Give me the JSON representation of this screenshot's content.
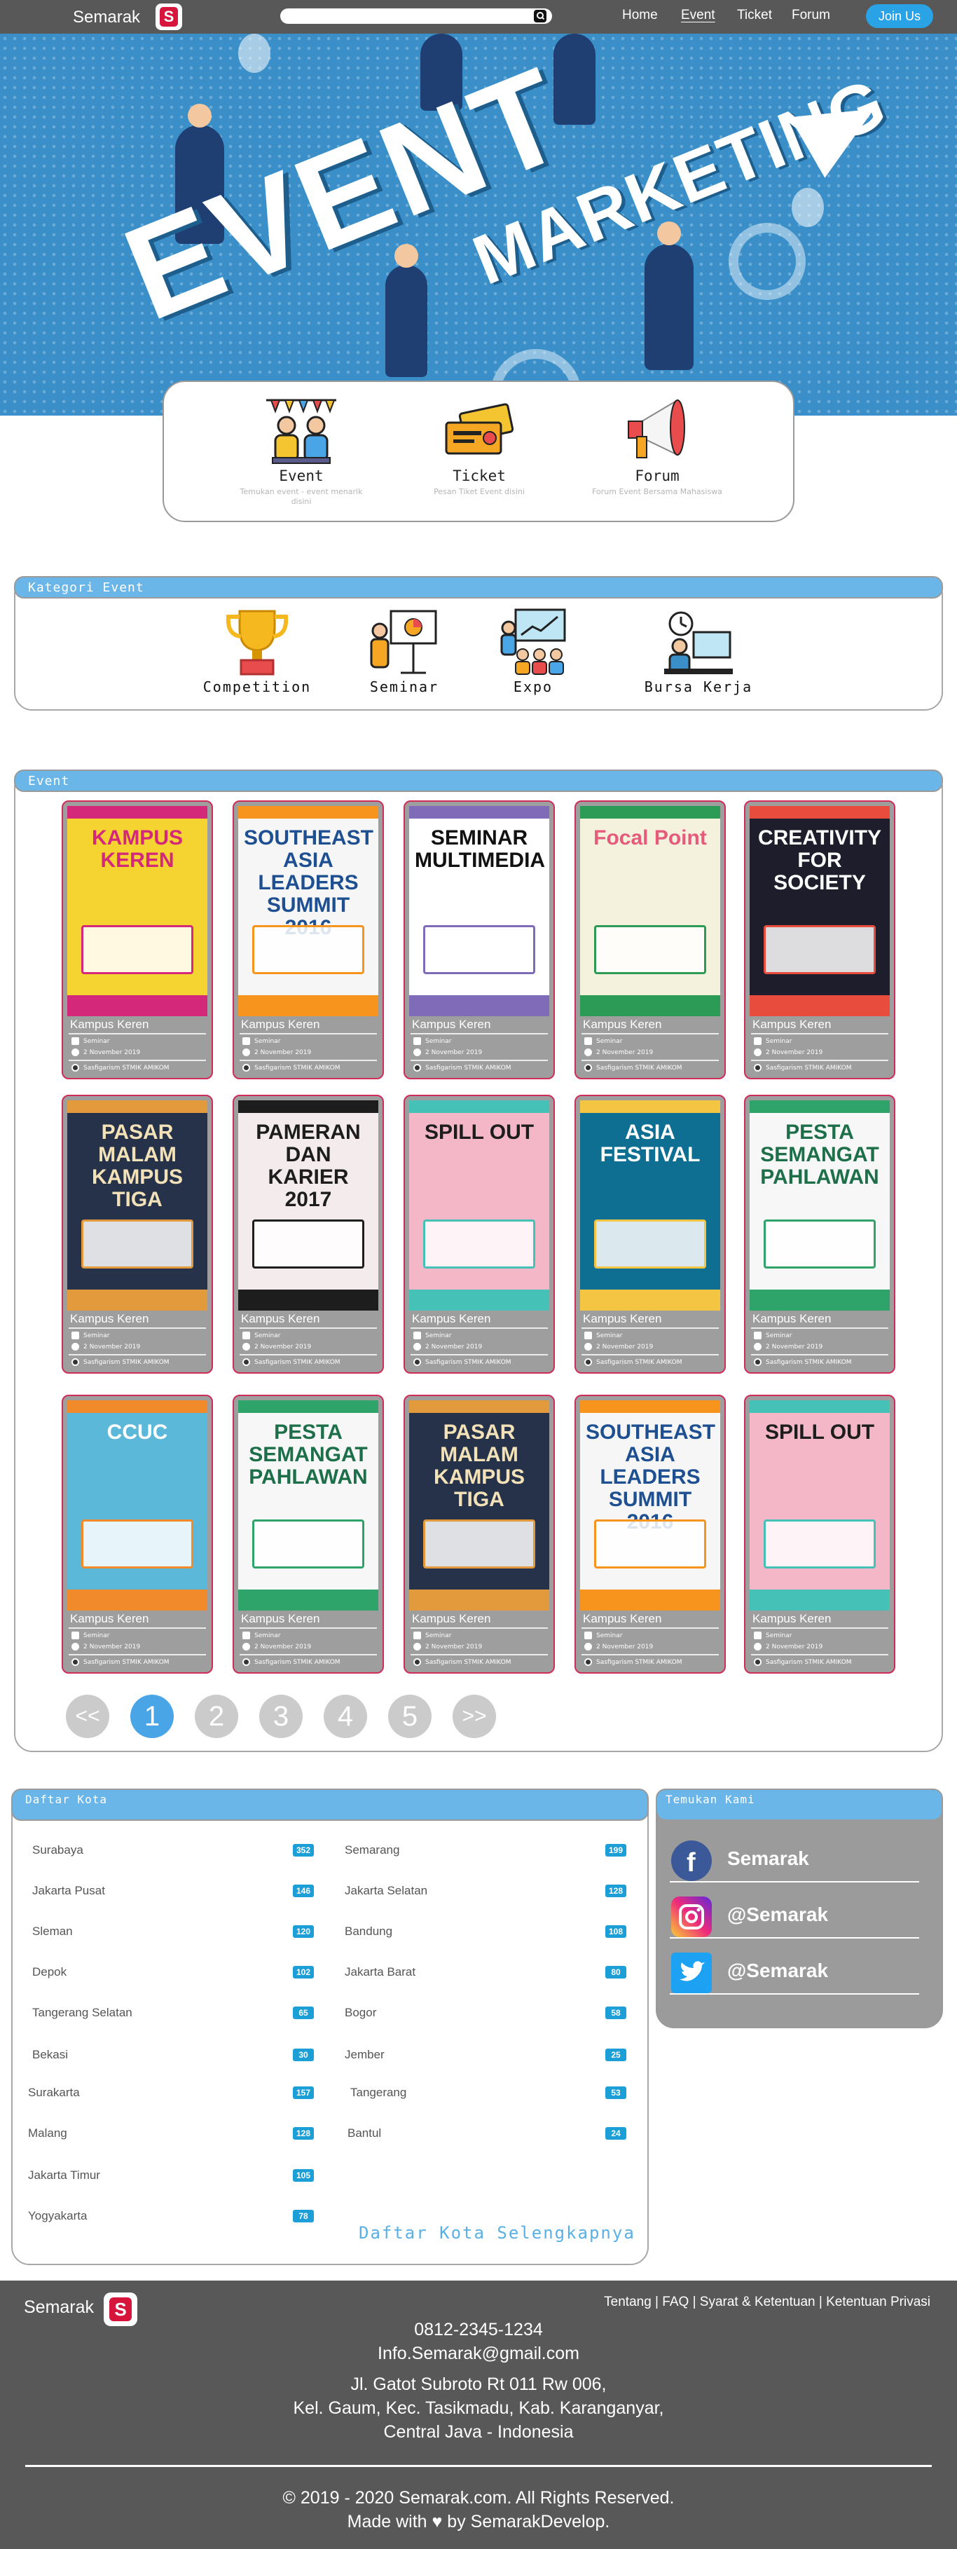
{
  "navbar": {
    "brand": "Semarak",
    "logo_letter": "S",
    "search_placeholder": "",
    "links": [
      "Home",
      "Event",
      "Ticket",
      "Forum"
    ],
    "active_link": "Event",
    "join_label": "Join Us"
  },
  "hero": {
    "headline_1": "EVENT",
    "headline_2": "MARKETING",
    "slides": 4,
    "active_slide": 1
  },
  "services": [
    {
      "title": "Event",
      "desc": "Temukan event - event menarik disini",
      "icon": "event-celebration-icon"
    },
    {
      "title": "Ticket",
      "desc": "Pesan Tiket Event disini",
      "icon": "ticket-icon"
    },
    {
      "title": "Forum",
      "desc": "Forum Event Bersama Mahasiswa",
      "icon": "megaphone-icon"
    }
  ],
  "kategori": {
    "heading": "Kategori Event",
    "items": [
      {
        "label": "Competition",
        "icon": "trophy-icon"
      },
      {
        "label": "Seminar",
        "icon": "presentation-icon"
      },
      {
        "label": "Expo",
        "icon": "expo-icon"
      },
      {
        "label": "Bursa Kerja",
        "icon": "job-fair-icon"
      }
    ]
  },
  "events": {
    "heading": "Event",
    "items": [
      {
        "title": "Kampus Keren",
        "category": "Seminar",
        "date": "2 November 2019",
        "organizer": "Sasfigarism STMIK AMIKOM",
        "poster": {
          "bg": "#f5d431",
          "accent": "#d4297b",
          "text": "KAMPUS KEREN",
          "text_color": "#d4297b"
        }
      },
      {
        "title": "Kampus Keren",
        "category": "Seminar",
        "date": "2 November 2019",
        "organizer": "Sasfigarism STMIK AMIKOM",
        "poster": {
          "bg": "#f6f6f6",
          "accent": "#f7941d",
          "text": "SOUTHEAST ASIA LEADERS SUMMIT 2016",
          "text_color": "#1d4f91"
        }
      },
      {
        "title": "Kampus Keren",
        "category": "Seminar",
        "date": "2 November 2019",
        "organizer": "Sasfigarism STMIK AMIKOM",
        "poster": {
          "bg": "#ffffff",
          "accent": "#7f6bb8",
          "text": "SEMINAR MULTIMEDIA",
          "text_color": "#111111"
        }
      },
      {
        "title": "Kampus Keren",
        "category": "Seminar",
        "date": "2 November 2019",
        "organizer": "Sasfigarism STMIK AMIKOM",
        "poster": {
          "bg": "#f4f1dc",
          "accent": "#2c9b55",
          "text": "Focal Point",
          "text_color": "#e65b7c"
        }
      },
      {
        "title": "Kampus Keren",
        "category": "Seminar",
        "date": "2 November 2019",
        "organizer": "Sasfigarism STMIK AMIKOM",
        "poster": {
          "bg": "#1d1d2b",
          "accent": "#e74c3c",
          "text": "CREATIVITY FOR SOCIETY",
          "text_color": "#ffffff"
        }
      },
      {
        "title": "Kampus Keren",
        "category": "Seminar",
        "date": "2 November 2019",
        "organizer": "Sasfigarism STMIK AMIKOM",
        "poster": {
          "bg": "#26324a",
          "accent": "#e39a3c",
          "text": "PASAR MALAM KAMPUS TIGA",
          "text_color": "#f3e2b8"
        }
      },
      {
        "title": "Kampus Keren",
        "category": "Seminar",
        "date": "2 November 2019",
        "organizer": "Sasfigarism STMIK AMIKOM",
        "poster": {
          "bg": "#f4ecec",
          "accent": "#1d1d1d",
          "text": "PAMERAN DAN KARIER 2017",
          "text_color": "#1d1d1d"
        }
      },
      {
        "title": "Kampus Keren",
        "category": "Seminar",
        "date": "2 November 2019",
        "organizer": "Sasfigarism STMIK AMIKOM",
        "poster": {
          "bg": "#f3b7c8",
          "accent": "#46c1b8",
          "text": "SPILL OUT",
          "text_color": "#1d1d1d"
        }
      },
      {
        "title": "Kampus Keren",
        "category": "Seminar",
        "date": "2 November 2019",
        "organizer": "Sasfigarism STMIK AMIKOM",
        "poster": {
          "bg": "#0f6f93",
          "accent": "#f4c542",
          "text": "ASIA FESTIVAL",
          "text_color": "#ffffff"
        }
      },
      {
        "title": "Kampus Keren",
        "category": "Seminar",
        "date": "2 November 2019",
        "organizer": "Sasfigarism STMIK AMIKOM",
        "poster": {
          "bg": "#f7f7f7",
          "accent": "#2ea36a",
          "text": "PESTA SEMANGAT PAHLAWAN",
          "text_color": "#1d6f4a"
        }
      },
      {
        "title": "Kampus Keren",
        "category": "Seminar",
        "date": "2 November 2019",
        "organizer": "Sasfigarism STMIK AMIKOM",
        "poster": {
          "bg": "#5cb8d9",
          "accent": "#f08a2b",
          "text": "CCUC",
          "text_color": "#ffffff"
        }
      },
      {
        "title": "Kampus Keren",
        "category": "Seminar",
        "date": "2 November 2019",
        "organizer": "Sasfigarism STMIK AMIKOM",
        "poster": {
          "bg": "#f7f7f7",
          "accent": "#2ea36a",
          "text": "PESTA SEMANGAT PAHLAWAN",
          "text_color": "#1d6f4a"
        }
      },
      {
        "title": "Kampus Keren",
        "category": "Seminar",
        "date": "2 November 2019",
        "organizer": "Sasfigarism STMIK AMIKOM",
        "poster": {
          "bg": "#26324a",
          "accent": "#e39a3c",
          "text": "PASAR MALAM KAMPUS TIGA",
          "text_color": "#f3e2b8"
        }
      },
      {
        "title": "Kampus Keren",
        "category": "Seminar",
        "date": "2 November 2019",
        "organizer": "Sasfigarism STMIK AMIKOM",
        "poster": {
          "bg": "#f6f6f6",
          "accent": "#f7941d",
          "text": "SOUTHEAST ASIA LEADERS SUMMIT 2016",
          "text_color": "#1d4f91"
        }
      },
      {
        "title": "Kampus Keren",
        "category": "Seminar",
        "date": "2 November 2019",
        "organizer": "Sasfigarism STMIK AMIKOM",
        "poster": {
          "bg": "#f3b7c8",
          "accent": "#46c1b8",
          "text": "SPILL OUT",
          "text_color": "#1d1d1d"
        }
      }
    ],
    "pagination": [
      "<<",
      "1",
      "2",
      "3",
      "4",
      "5",
      ">>"
    ],
    "active_page": "1"
  },
  "kota": {
    "heading": "Daftar Kota",
    "left": [
      {
        "name": "Surabaya",
        "count": "352"
      },
      {
        "name": "Jakarta Pusat",
        "count": "146"
      },
      {
        "name": "Sleman",
        "count": "120"
      },
      {
        "name": "Depok",
        "count": "102"
      },
      {
        "name": "Tangerang Selatan",
        "count": "65"
      },
      {
        "name": "Bekasi",
        "count": "30"
      },
      {
        "name": "Surakarta",
        "count": "157"
      },
      {
        "name": "Malang",
        "count": "128"
      },
      {
        "name": "Jakarta Timur",
        "count": "105"
      },
      {
        "name": "Yogyakarta",
        "count": "78"
      }
    ],
    "right": [
      {
        "name": "Semarang",
        "count": "199"
      },
      {
        "name": "Jakarta Selatan",
        "count": "128"
      },
      {
        "name": "Bandung",
        "count": "108"
      },
      {
        "name": "Jakarta Barat",
        "count": "80"
      },
      {
        "name": "Bogor",
        "count": "58"
      },
      {
        "name": "Jember",
        "count": "25"
      },
      {
        "name": "Tangerang",
        "count": "53"
      },
      {
        "name": "Bantul",
        "count": "24"
      }
    ],
    "more_label": "Daftar Kota Selengkapnya"
  },
  "social": {
    "heading": "Temukan Kami",
    "items": [
      {
        "label": "Semarak",
        "icon": "facebook-icon",
        "color": "#3b5998"
      },
      {
        "label": "@Semarak",
        "icon": "instagram-icon",
        "color": "#c13584"
      },
      {
        "label": "@Semarak",
        "icon": "twitter-icon",
        "color": "#1da1f2"
      }
    ]
  },
  "footer": {
    "brand": "Semarak",
    "logo_letter": "S",
    "links": [
      "Tentang",
      "FAQ",
      "Syarat & Ketentuan",
      "Ketentuan Privasi"
    ],
    "phone": "0812-2345-1234",
    "email": "Info.Semarak@gmail.com",
    "address_1": "Jl. Gatot Subroto Rt 011 Rw 006,",
    "address_2": "Kel. Gaum, Kec. Tasikmadu, Kab. Karanganyar,",
    "address_3": "Central Java - Indonesia",
    "copyright": "© 2019 - 2020 Semarak.com. All Rights Reserved.",
    "made_with": "Made with ♥ by SemarakDevelop."
  }
}
